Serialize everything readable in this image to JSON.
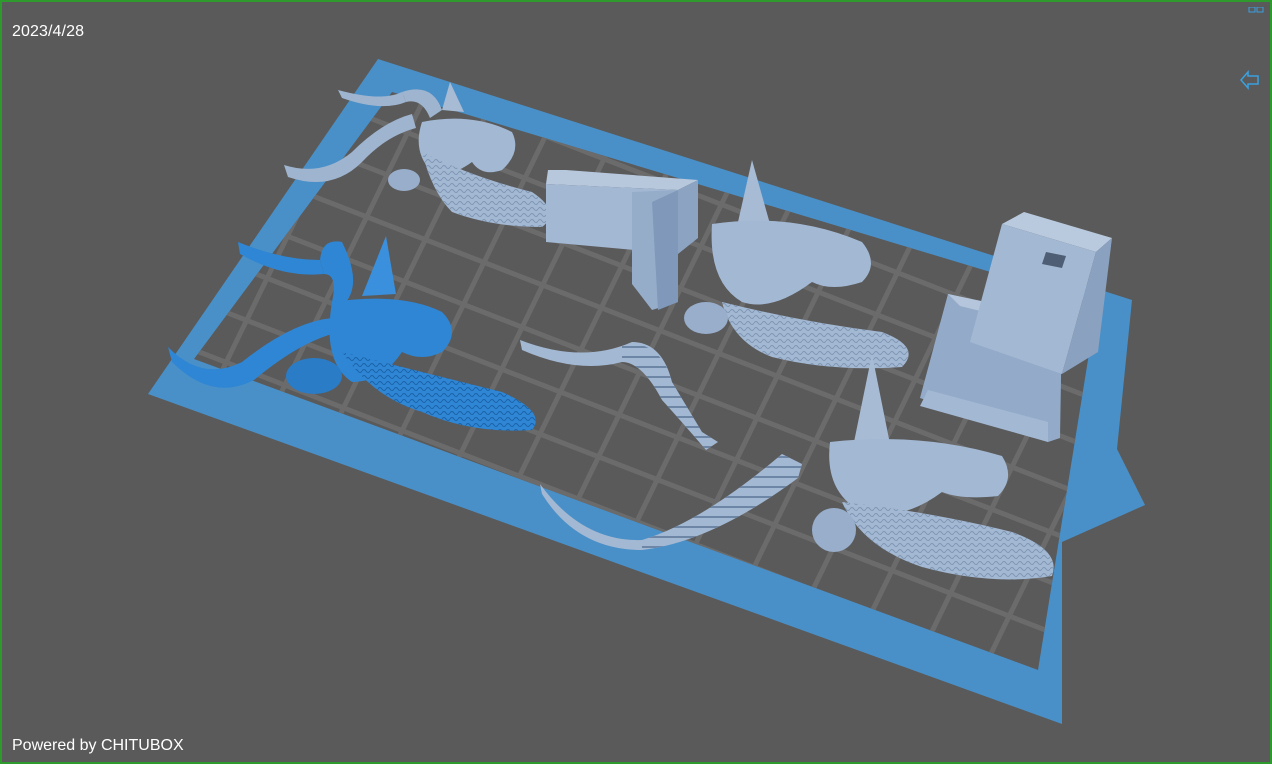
{
  "viewport": {
    "date": "2023/4/28",
    "powered_by": "Powered by CHITUBOX"
  },
  "icons": {
    "nav": "arrow-left-icon",
    "corner": "window-corner-icon"
  },
  "colors": {
    "background": "#5a5a5a",
    "frame_border": "#2e9a2e",
    "build_plate": "#4a90c8",
    "grid": "#6b6b6b",
    "model": "#a3b8d3",
    "model_selected": "#2f86d4",
    "text": "#ffffff"
  },
  "scene": {
    "models": [
      {
        "name": "antelope-head",
        "selected": false
      },
      {
        "name": "antelope-head",
        "selected": true
      },
      {
        "name": "antelope-head",
        "selected": false
      },
      {
        "name": "antelope-head",
        "selected": false
      },
      {
        "name": "horn",
        "selected": false
      },
      {
        "name": "horn",
        "selected": false
      },
      {
        "name": "mount-base",
        "selected": false
      },
      {
        "name": "pedestal",
        "selected": false
      }
    ]
  }
}
